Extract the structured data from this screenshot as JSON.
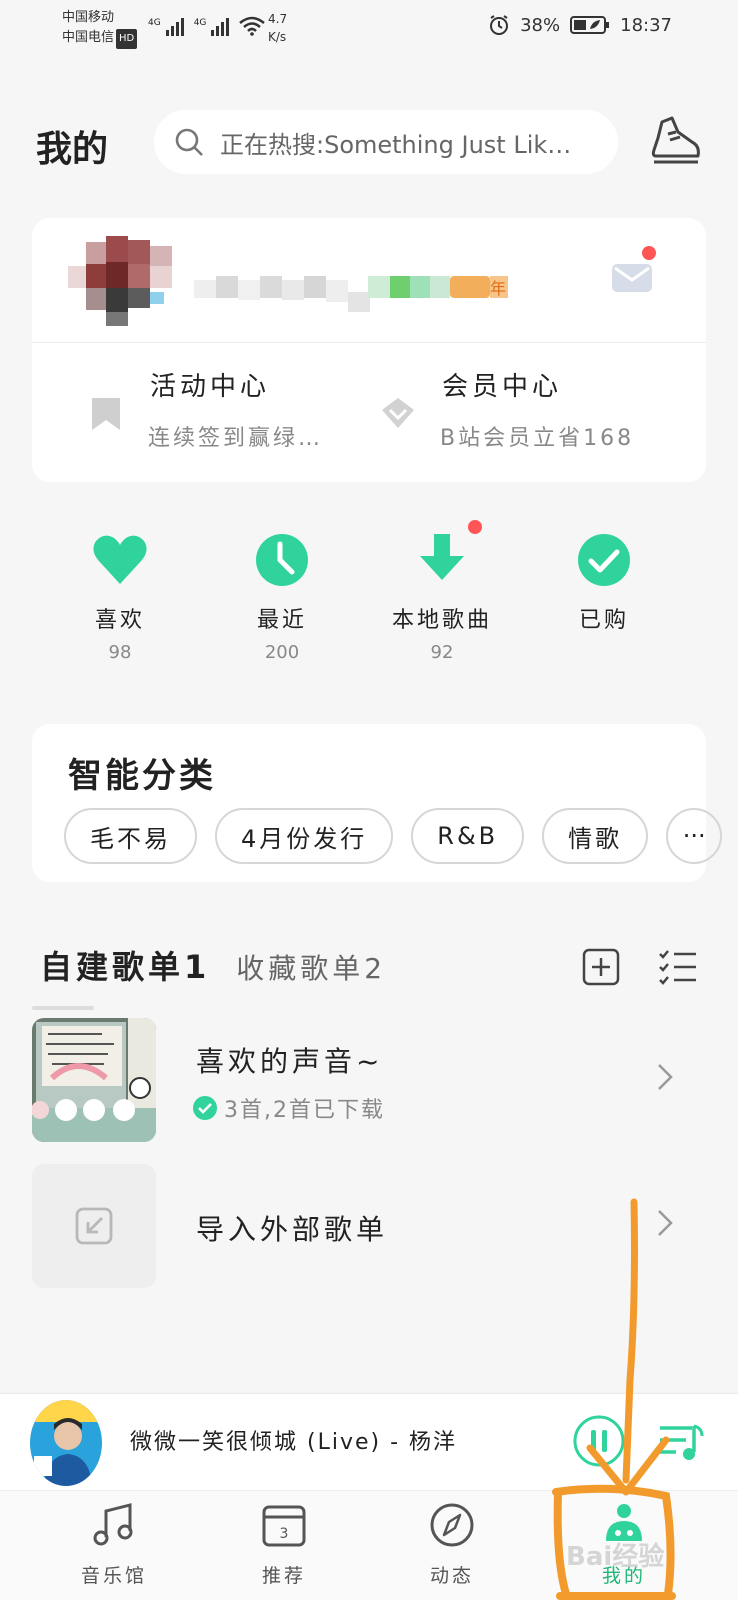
{
  "status_bar": {
    "carrier_1": "中国移动",
    "carrier_2": "中国电信",
    "hd": "HD",
    "net_1": "4G",
    "net_2": "4G",
    "speed_value": "4.7",
    "speed_unit": "K/s",
    "battery": "38%",
    "time": "18:37"
  },
  "header": {
    "title": "我的",
    "search_placeholder": "正在热搜:Something Just Lik…"
  },
  "profile": {
    "vip_badge": "年",
    "activity": {
      "title": "活动中心",
      "subtitle": "连续签到赢绿…"
    },
    "member": {
      "title": "会员中心",
      "subtitle": "B站会员立省168"
    }
  },
  "stats": [
    {
      "label": "喜欢",
      "count": "98",
      "icon": "heart-icon"
    },
    {
      "label": "最近",
      "count": "200",
      "icon": "clock-icon"
    },
    {
      "label": "本地歌曲",
      "count": "92",
      "icon": "download-icon"
    },
    {
      "label": "已购",
      "count": "",
      "icon": "check-circle-icon"
    }
  ],
  "smart_category": {
    "title": "智能分类",
    "chips": [
      "毛不易",
      "4月份发行",
      "R&B",
      "情歌",
      "···"
    ]
  },
  "playlist_tabs": {
    "created": "自建歌单1",
    "collected": "收藏歌单2"
  },
  "playlists": [
    {
      "name": "喜欢的声音~",
      "meta": "3首,2首已下载"
    },
    {
      "name": "导入外部歌单"
    }
  ],
  "player": {
    "song": "微微一笑很倾城 (Live) - 杨洋"
  },
  "bottom_nav": [
    {
      "label": "音乐馆"
    },
    {
      "label": "推荐",
      "icon_text": "3"
    },
    {
      "label": "动态"
    },
    {
      "label": "我的"
    }
  ],
  "colors": {
    "accent": "#2fd39b",
    "accent_dark": "#1fb777",
    "annotation": "#f29b2c",
    "red_dot": "#ff5a5a"
  },
  "watermark": "Bai经验"
}
